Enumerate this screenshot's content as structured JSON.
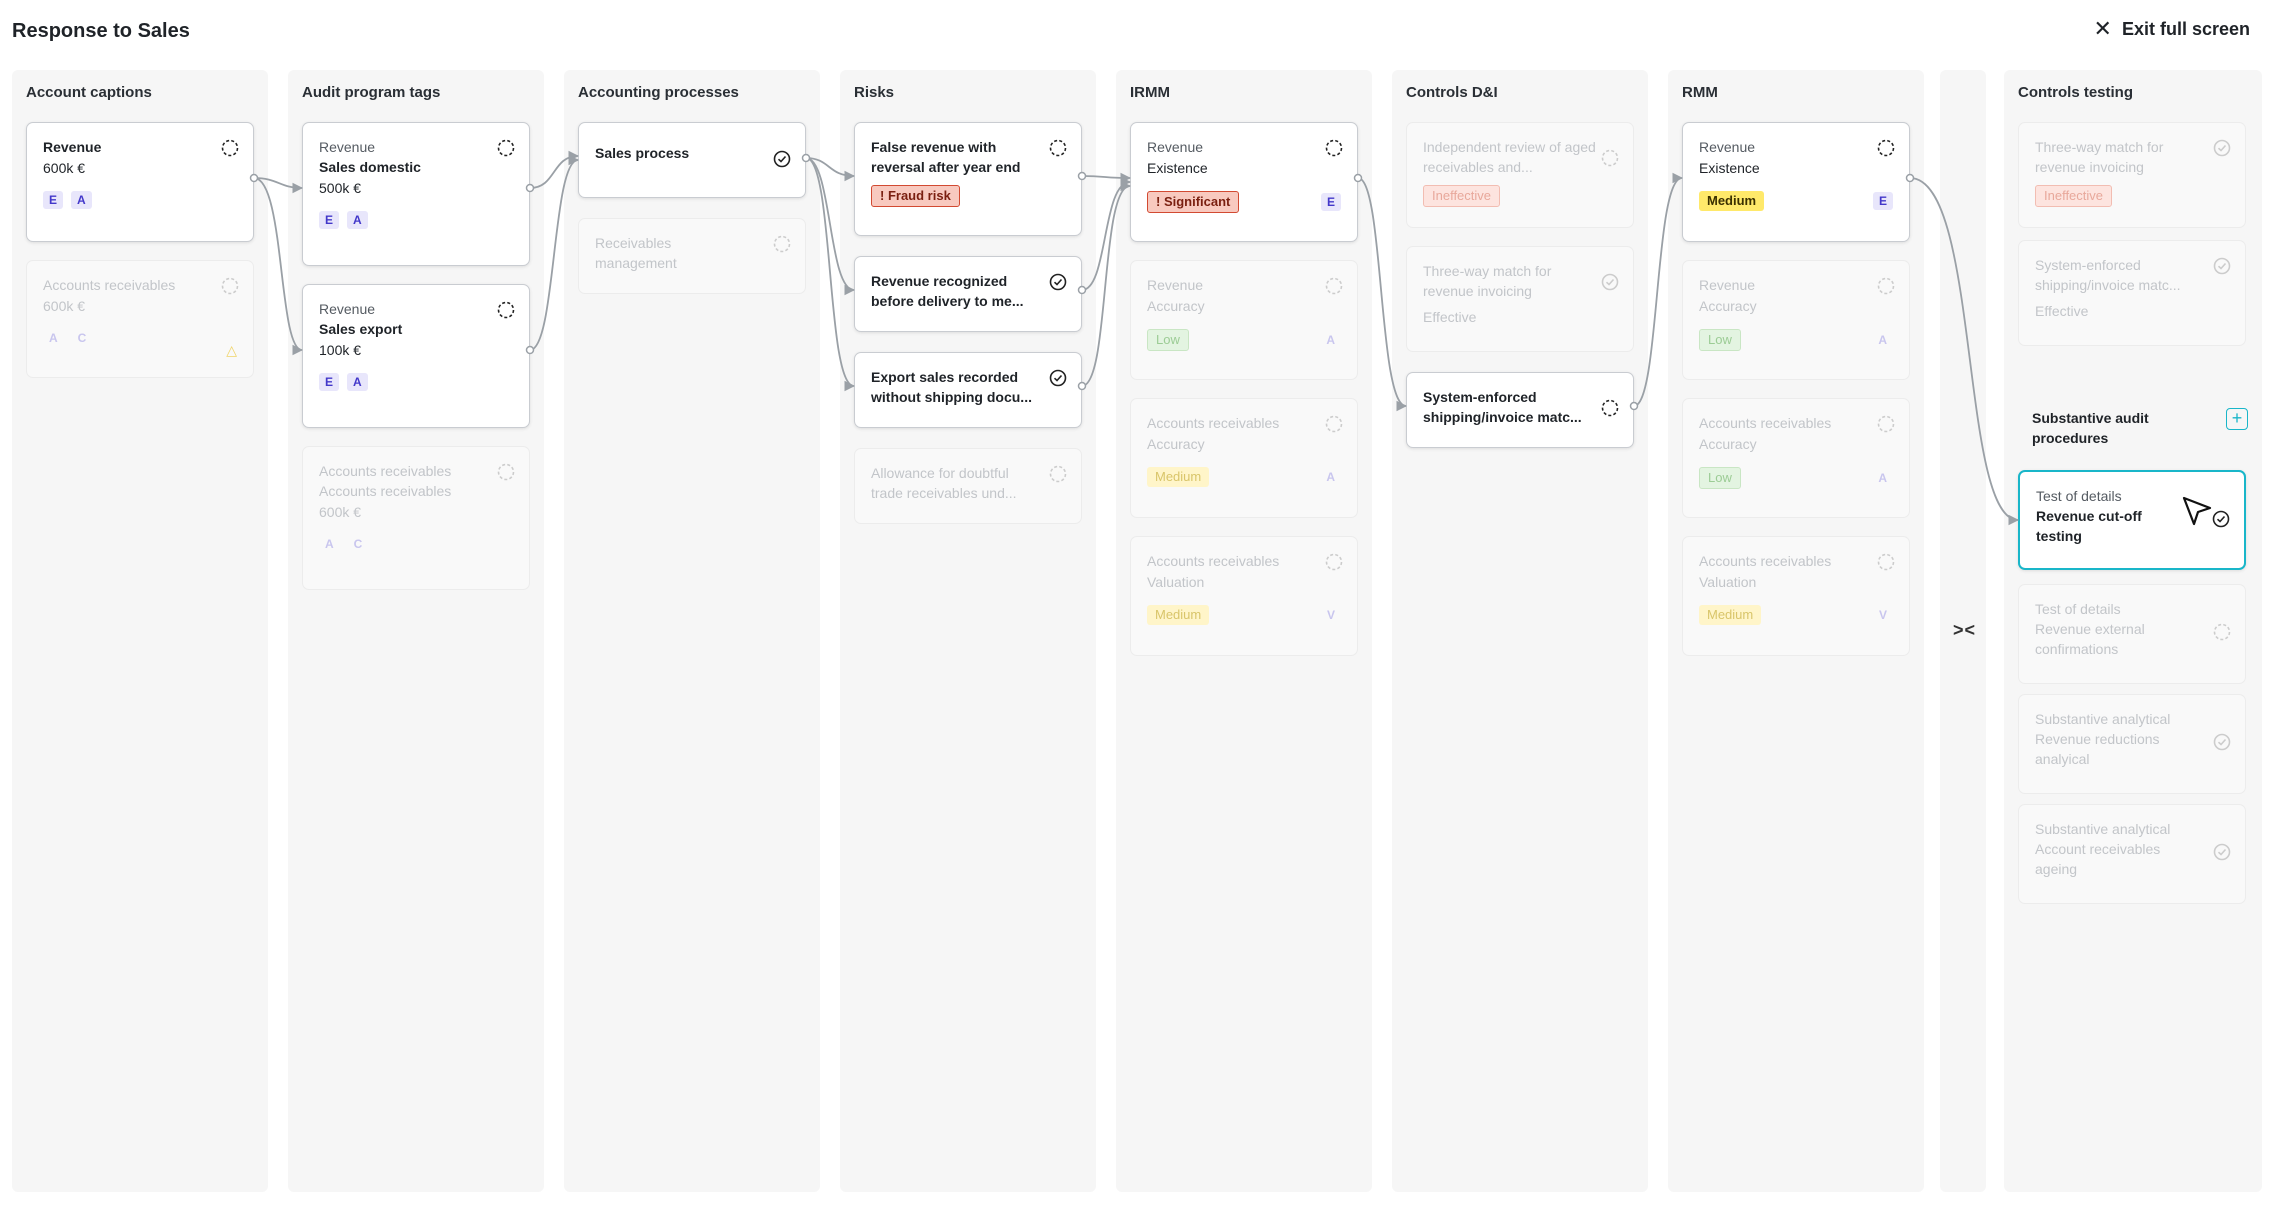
{
  "header": {
    "title": "Response to Sales",
    "exit_label": "Exit full screen"
  },
  "columns": {
    "account_captions": "Account captions",
    "audit_program_tags": "Audit program tags",
    "accounting_processes": "Accounting processes",
    "risks": "Risks",
    "irmm": "IRMM",
    "controls_di": "Controls D&I",
    "rmm": "RMM",
    "controls_testing": "Controls testing"
  },
  "captions": [
    {
      "title": "Revenue",
      "value": "600k €",
      "tags": [
        "E",
        "A"
      ]
    },
    {
      "title": "Accounts receivables",
      "value": "600k €",
      "tags": [
        "A",
        "C"
      ]
    }
  ],
  "tags": [
    {
      "small": "Revenue",
      "title": "Sales domestic",
      "value": "500k €",
      "tags": [
        "E",
        "A"
      ]
    },
    {
      "small": "Revenue",
      "title": "Sales export",
      "value": "100k €",
      "tags": [
        "E",
        "A"
      ]
    },
    {
      "small": "Accounts receivables",
      "title": "Accounts receivables",
      "value": "600k €",
      "tags": [
        "A",
        "C"
      ]
    }
  ],
  "processes": [
    {
      "title": "Sales process"
    },
    {
      "title": "Receivables management"
    }
  ],
  "risks": [
    {
      "title": "False revenue with reversal after year end",
      "badge": "! Fraud risk"
    },
    {
      "title": "Revenue recognized before delivery to me..."
    },
    {
      "title": "Export sales recorded without shipping docu..."
    },
    {
      "title": "Allowance for doubtful trade receivables und..."
    }
  ],
  "irmm": [
    {
      "small": "Revenue",
      "title": "Existence",
      "badge": "! Significant",
      "letter": "E"
    },
    {
      "small": "Revenue",
      "title": "Accuracy",
      "badge": "Low",
      "letter": "A"
    },
    {
      "small": "Accounts receivables",
      "title": "Accuracy",
      "badge": "Medium",
      "letter": "A"
    },
    {
      "small": "Accounts receivables",
      "title": "Valuation",
      "badge": "Medium",
      "letter": "V"
    }
  ],
  "controls_di": [
    {
      "title": "Independent review of aged receivables and...",
      "badge": "Ineffective"
    },
    {
      "title": "Three-way match for revenue invoicing",
      "status": "Effective"
    },
    {
      "title": "System-enforced shipping/invoice matc..."
    }
  ],
  "rmm": [
    {
      "small": "Revenue",
      "title": "Existence",
      "badge": "Medium",
      "letter": "E"
    },
    {
      "small": "Revenue",
      "title": "Accuracy",
      "badge": "Low",
      "letter": "A"
    },
    {
      "small": "Accounts receivables",
      "title": "Accuracy",
      "badge": "Low",
      "letter": "A"
    },
    {
      "small": "Accounts receivables",
      "title": "Valuation",
      "badge": "Medium",
      "letter": "V"
    }
  ],
  "controls_testing": [
    {
      "title": "Three-way match for revenue invoicing",
      "badge": "Ineffective"
    },
    {
      "title": "System-enforced shipping/invoice matc...",
      "status": "Effective"
    }
  ],
  "substantive": {
    "title": "Substantive audit procedures",
    "items": [
      {
        "small": "Test of details",
        "title": "Revenue cut-off testing"
      },
      {
        "small": "Test of details",
        "title": "Revenue external confirmations"
      },
      {
        "small": "Substantive analytical",
        "title": "Revenue reductions analyical"
      },
      {
        "small": "Substantive analytical",
        "title": "Account receivables ageing"
      }
    ]
  },
  "icons": {
    "close": "close-icon",
    "collapse": "collapse-columns-icon",
    "status_pending": "dashed-circle-icon",
    "status_done": "check-circle-icon",
    "warning": "warning-icon",
    "add": "plus-square-icon",
    "cursor": "pointer-cursor-icon"
  },
  "colors": {
    "accent": "#19b6c9",
    "tag_text": "#4338ca",
    "fraud": "#d24a32",
    "medium": "#ffe96a"
  }
}
